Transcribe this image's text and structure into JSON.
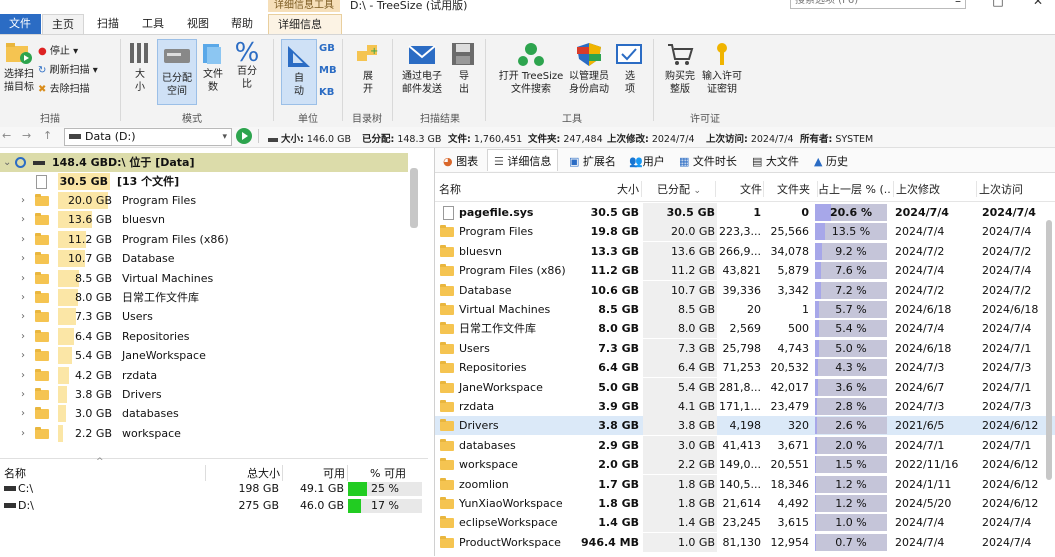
{
  "window": {
    "title": "D:\\ - TreeSize (试用版)",
    "context_tab_group": "详细信息工具",
    "search_placeholder": "搜索选项 (F6)",
    "controls": [
      "–",
      "□",
      "✕"
    ]
  },
  "ribbon_tabs": [
    "文件",
    "主页",
    "扫描",
    "工具",
    "视图",
    "帮助",
    "详细信息"
  ],
  "ribbon": {
    "scan_group": {
      "label": "扫描",
      "select_target": "选择扫\n描目标",
      "stop": "停止",
      "refresh": "刷新扫描",
      "remove": "去除扫描"
    },
    "mode_group": {
      "label": "模式",
      "size": "大\n小",
      "allocated": "已分配\n空间",
      "files": "文件\n数",
      "percent": "百分\n比"
    },
    "unit_group": {
      "label": "单位",
      "auto": "自\n动",
      "units": [
        "GB",
        "MB",
        "KB"
      ]
    },
    "tree_group": {
      "label": "目录树",
      "expand": "展\n开"
    },
    "results_group": {
      "label": "扫描结果",
      "email": "通过电子\n邮件发送",
      "export": "导\n出"
    },
    "tools_group": {
      "label": "工具",
      "open_search": "打开 TreeSize\n文件搜索",
      "admin": "以管理员\n身份启动",
      "options": "选\n项"
    },
    "license_group": {
      "label": "许可证",
      "buy": "购买完\n整版",
      "enter_key": "输入许可\n证密钥"
    }
  },
  "address": {
    "drive": "Data (D:)",
    "stats": [
      {
        "label": "大小:",
        "value": "146.0 GB"
      },
      {
        "label": "已分配:",
        "value": "148.3 GB"
      },
      {
        "label": "文件:",
        "value": "1,760,451"
      },
      {
        "label": "文件夹:",
        "value": "247,484"
      },
      {
        "label": "上次修改:",
        "value": "2024/7/4"
      },
      {
        "label": "上次访问:",
        "value": "2024/7/4"
      },
      {
        "label": "所有者:",
        "value": "SYSTEM"
      }
    ]
  },
  "tree": {
    "root": {
      "size": "148.4 GB",
      "name": "D:\\  位于  [Data]"
    },
    "files_node": {
      "size": "30.5 GB",
      "name": "[13 个文件]"
    },
    "items": [
      {
        "size": "20.0 GB",
        "name": "Program Files",
        "fill": 0.66
      },
      {
        "size": "13.6 GB",
        "name": "bluesvn",
        "fill": 0.45
      },
      {
        "size": "11.2 GB",
        "name": "Program Files (x86)",
        "fill": 0.37
      },
      {
        "size": "10.7 GB",
        "name": "Database",
        "fill": 0.35
      },
      {
        "size": "8.5 GB",
        "name": "Virtual Machines",
        "fill": 0.28
      },
      {
        "size": "8.0 GB",
        "name": "日常工作文件库",
        "fill": 0.26
      },
      {
        "size": "7.3 GB",
        "name": "Users",
        "fill": 0.24
      },
      {
        "size": "6.4 GB",
        "name": "Repositories",
        "fill": 0.21
      },
      {
        "size": "5.4 GB",
        "name": "JaneWorkspace",
        "fill": 0.18
      },
      {
        "size": "4.2 GB",
        "name": "rzdata",
        "fill": 0.14
      },
      {
        "size": "3.8 GB",
        "name": "Drivers",
        "fill": 0.12
      },
      {
        "size": "3.0 GB",
        "name": "databases",
        "fill": 0.1
      },
      {
        "size": "2.2 GB",
        "name": "workspace",
        "fill": 0.07
      }
    ]
  },
  "drives": {
    "headers": [
      "名称",
      "总大小",
      "可用",
      "% 可用"
    ],
    "rows": [
      {
        "name": "C:\\",
        "total": "198 GB",
        "free": "49.1 GB",
        "pct": "25 %",
        "fill": 0.25
      },
      {
        "name": "D:\\",
        "total": "275 GB",
        "free": "46.0 GB",
        "pct": "17 %",
        "fill": 0.17
      }
    ]
  },
  "right_tabs": [
    "图表",
    "详细信息",
    "扩展名",
    "用户",
    "文件时长",
    "大文件",
    "历史"
  ],
  "table": {
    "headers": [
      "名称",
      "大小",
      "已分配",
      "文件",
      "文件夹",
      "占上一层 % (...",
      "上次修改",
      "上次访问"
    ],
    "rows": [
      {
        "name": "pagefile.sys",
        "size": "30.5 GB",
        "alloc": "30.5 GB",
        "files": "1",
        "folders": "0",
        "pct": "20.6 %",
        "frac": 0.206,
        "mod": "2024/7/4",
        "acc": "2024/7/4",
        "file": true
      },
      {
        "name": "Program Files",
        "size": "19.8 GB",
        "alloc": "20.0 GB",
        "files": "223,3...",
        "folders": "25,566",
        "pct": "13.5 %",
        "frac": 0.135,
        "mod": "2024/7/4",
        "acc": "2024/7/4"
      },
      {
        "name": "bluesvn",
        "size": "13.3 GB",
        "alloc": "13.6 GB",
        "files": "266,9...",
        "folders": "34,078",
        "pct": "9.2 %",
        "frac": 0.092,
        "mod": "2024/7/2",
        "acc": "2024/7/2"
      },
      {
        "name": "Program Files (x86)",
        "size": "11.2 GB",
        "alloc": "11.2 GB",
        "files": "43,821",
        "folders": "5,879",
        "pct": "7.6 %",
        "frac": 0.076,
        "mod": "2024/7/4",
        "acc": "2024/7/4"
      },
      {
        "name": "Database",
        "size": "10.6 GB",
        "alloc": "10.7 GB",
        "files": "39,336",
        "folders": "3,342",
        "pct": "7.2 %",
        "frac": 0.072,
        "mod": "2024/7/2",
        "acc": "2024/7/2"
      },
      {
        "name": "Virtual Machines",
        "size": "8.5 GB",
        "alloc": "8.5 GB",
        "files": "20",
        "folders": "1",
        "pct": "5.7 %",
        "frac": 0.057,
        "mod": "2024/6/18",
        "acc": "2024/6/18"
      },
      {
        "name": "日常工作文件库",
        "size": "8.0 GB",
        "alloc": "8.0 GB",
        "files": "2,569",
        "folders": "500",
        "pct": "5.4 %",
        "frac": 0.054,
        "mod": "2024/7/4",
        "acc": "2024/7/4"
      },
      {
        "name": "Users",
        "size": "7.3 GB",
        "alloc": "7.3 GB",
        "files": "25,798",
        "folders": "4,743",
        "pct": "5.0 %",
        "frac": 0.05,
        "mod": "2024/6/18",
        "acc": "2024/7/1"
      },
      {
        "name": "Repositories",
        "size": "6.4 GB",
        "alloc": "6.4 GB",
        "files": "71,253",
        "folders": "20,532",
        "pct": "4.3 %",
        "frac": 0.043,
        "mod": "2024/7/3",
        "acc": "2024/7/3"
      },
      {
        "name": "JaneWorkspace",
        "size": "5.0 GB",
        "alloc": "5.4 GB",
        "files": "281,8...",
        "folders": "42,017",
        "pct": "3.6 %",
        "frac": 0.036,
        "mod": "2024/6/7",
        "acc": "2024/7/1"
      },
      {
        "name": "rzdata",
        "size": "3.9 GB",
        "alloc": "4.1 GB",
        "files": "171,1...",
        "folders": "23,479",
        "pct": "2.8 %",
        "frac": 0.028,
        "mod": "2024/7/3",
        "acc": "2024/7/3"
      },
      {
        "name": "Drivers",
        "size": "3.8 GB",
        "alloc": "3.8 GB",
        "files": "4,198",
        "folders": "320",
        "pct": "2.6 %",
        "frac": 0.026,
        "mod": "2021/6/5",
        "acc": "2024/6/12",
        "selected": true
      },
      {
        "name": "databases",
        "size": "2.9 GB",
        "alloc": "3.0 GB",
        "files": "41,413",
        "folders": "3,671",
        "pct": "2.0 %",
        "frac": 0.02,
        "mod": "2024/7/1",
        "acc": "2024/7/1"
      },
      {
        "name": "workspace",
        "size": "2.0 GB",
        "alloc": "2.2 GB",
        "files": "149,0...",
        "folders": "20,551",
        "pct": "1.5 %",
        "frac": 0.015,
        "mod": "2022/11/16",
        "acc": "2024/6/12"
      },
      {
        "name": "zoomlion",
        "size": "1.7 GB",
        "alloc": "1.8 GB",
        "files": "140,5...",
        "folders": "18,346",
        "pct": "1.2 %",
        "frac": 0.012,
        "mod": "2024/1/11",
        "acc": "2024/6/12"
      },
      {
        "name": "YunXiaoWorkspace",
        "size": "1.8 GB",
        "alloc": "1.8 GB",
        "files": "21,614",
        "folders": "4,492",
        "pct": "1.2 %",
        "frac": 0.012,
        "mod": "2024/5/20",
        "acc": "2024/6/12"
      },
      {
        "name": "eclipseWorkspace",
        "size": "1.4 GB",
        "alloc": "1.4 GB",
        "files": "23,245",
        "folders": "3,615",
        "pct": "1.0 %",
        "frac": 0.01,
        "mod": "2024/7/4",
        "acc": "2024/7/4"
      },
      {
        "name": "ProductWorkspace",
        "size": "946.4 MB",
        "alloc": "1.0 GB",
        "files": "81,130",
        "folders": "12,954",
        "pct": "0.7 %",
        "frac": 0.007,
        "mod": "2024/7/4",
        "acc": "2024/7/4"
      }
    ]
  },
  "colors": {
    "accent": "#2b6cc4",
    "tree_bar": "#fbe6a6",
    "pct_bar": "#a7a7e9",
    "drive_free": "#22cc22",
    "selected_row": "#dbe9f8"
  }
}
